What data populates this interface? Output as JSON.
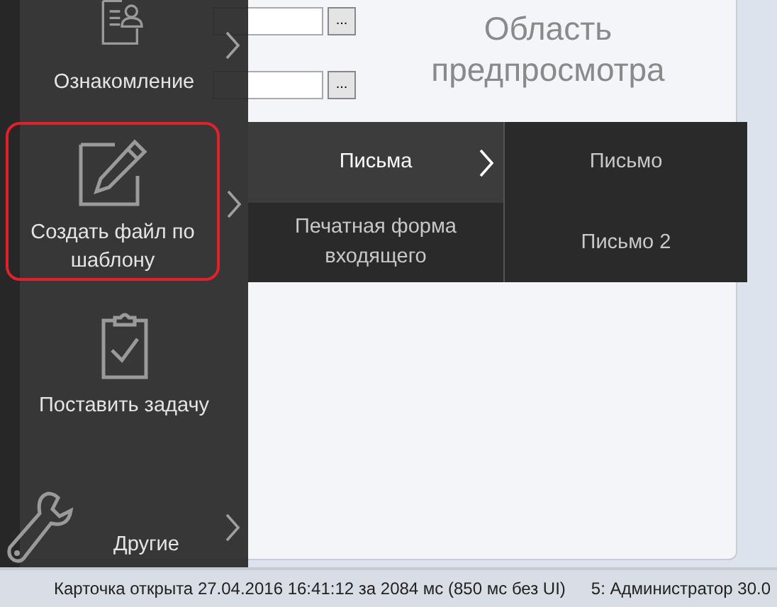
{
  "form": {
    "browse_buttons": [
      "...",
      "..."
    ]
  },
  "preview": {
    "text": "Область предпросмотра"
  },
  "menu": {
    "items": [
      {
        "label": "Ознакомление",
        "kind": "tile",
        "selected": false,
        "has_submenu": true
      },
      {
        "label": "Создать файл по шаблону",
        "kind": "tile",
        "selected": true,
        "has_submenu": true
      },
      {
        "label": "Поставить задачу",
        "kind": "tile",
        "selected": false,
        "has_submenu": false
      },
      {
        "label": "Другие",
        "kind": "compact",
        "selected": false,
        "has_submenu": true
      }
    ]
  },
  "submenu": {
    "items": [
      {
        "label": "Письма",
        "selected": true,
        "has_submenu": true
      },
      {
        "label": "Печатная форма входящего",
        "selected": false,
        "has_submenu": false
      }
    ]
  },
  "submenu_2": {
    "items": [
      {
        "label": "Письмо"
      },
      {
        "label": "Письмо 2"
      }
    ]
  },
  "status_bar": {
    "card_info": "Карточка открыта 27.04.2016 16:41:12 за 2084 мс (850 мс без UI)",
    "user": "5:  Администратор  30.0"
  }
}
